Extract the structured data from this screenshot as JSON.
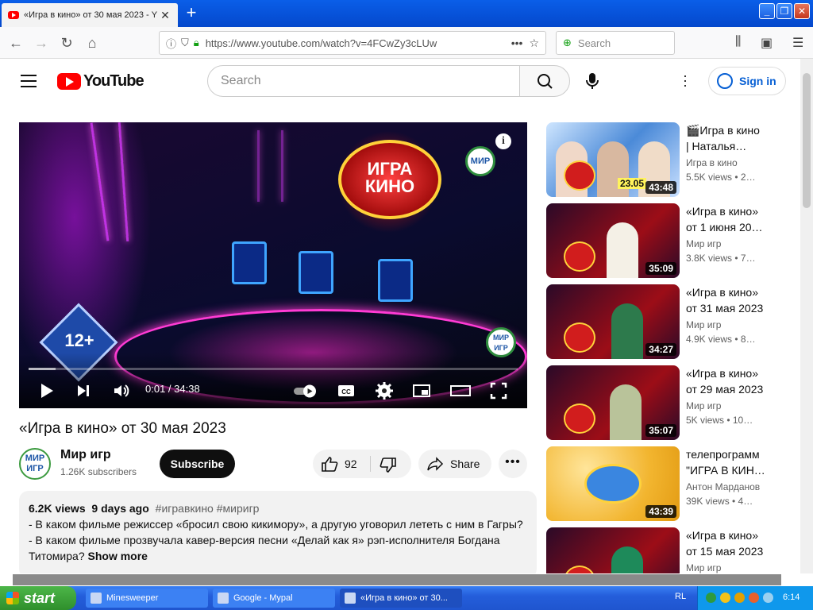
{
  "browser": {
    "tab_title": "«Игра в кино» от 30 мая 2023 - Y",
    "url": "https://www.youtube.com/watch?v=4FCwZy3cLUw",
    "search_placeholder": "Search",
    "window_controls": [
      "minimize",
      "restore",
      "close"
    ]
  },
  "youtube": {
    "logo_text": "YouTube",
    "search_placeholder": "Search",
    "sign_in": "Sign in",
    "brand_color": "#ff0000",
    "link_color": "#065fd4"
  },
  "player": {
    "age_rating": "12+",
    "channel_watermark": "МИР ИГР",
    "corner_logo": "МИР",
    "show_logo": "ИГРА КИНО",
    "time": "0:01 / 34:38",
    "progress_fraction": 0.0005
  },
  "video": {
    "title": "«Игра в кино» от 30 мая 2023",
    "channel": {
      "name": "Мир игр",
      "avatar_text": "МИР ИГР",
      "subscribers": "1.26K subscribers"
    },
    "subscribe_label": "Subscribe",
    "likes": "92",
    "share_label": "Share",
    "description": {
      "views": "6.2K views",
      "age": "9 days ago",
      "hashtags": "#игравкино #миригр",
      "line1": "- В каком фильме режиссер «бросил свою кикимору», а другую уговорил лететь с ним в Гагры?",
      "line2": "- В каком фильме прозвучала кавер-версия песни «Делай как я» рэп-исполнителя Богдана",
      "line3": "Титомира?",
      "show_more": "Show more"
    }
  },
  "related": [
    {
      "title": "🎬Игра в кино\n| Наталья…",
      "channel": "Игра в кино",
      "views": "5.5K views • 2…",
      "duration": "43:48",
      "date_tag": "23.05",
      "style": "blue"
    },
    {
      "title": "«Игра в кино»\nот 1 июня 20…",
      "channel": "Мир игр",
      "views": "3.8K views • 7…",
      "duration": "35:09",
      "style": "red"
    },
    {
      "title": "«Игра в кино»\nот 31 мая 2023",
      "channel": "Мир игр",
      "views": "4.9K views • 8…",
      "duration": "34:27",
      "style": "red"
    },
    {
      "title": "«Игра в кино»\nот 29 мая 2023",
      "channel": "Мир игр",
      "views": "5K views • 10…",
      "duration": "35:07",
      "style": "red"
    },
    {
      "title": "телепрограмм\n\"ИГРА В КИН…",
      "channel": "Антон Марданов",
      "views": "39K views • 4…",
      "duration": "43:39",
      "style": "gold"
    },
    {
      "title": "«Игра в кино»\nот 15 мая 2023",
      "channel": "Мир игр",
      "views": "",
      "duration": "",
      "style": "red"
    }
  ],
  "taskbar": {
    "start": "start",
    "tasks": [
      "Minesweeper",
      "Google - Mypal",
      "«Игра в кино» от 30..."
    ],
    "language": "RL",
    "clock": "6:14"
  }
}
